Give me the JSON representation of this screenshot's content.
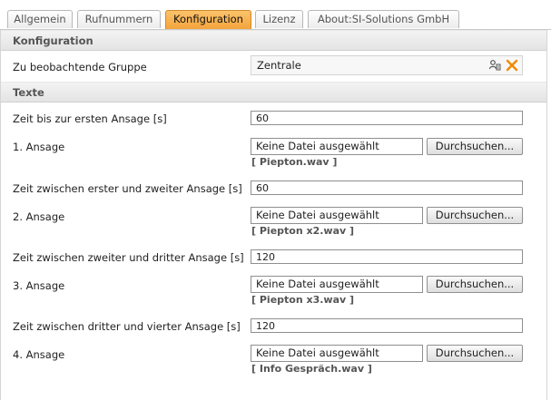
{
  "tabs": [
    {
      "label": "Allgemein"
    },
    {
      "label": "Rufnummern"
    },
    {
      "label": "Konfiguration"
    },
    {
      "label": "Lizenz"
    },
    {
      "label": "About:SI-Solutions GmbH"
    }
  ],
  "active_tab_color": "#f4a43b",
  "section_konfiguration": {
    "title": "Konfiguration",
    "group_label": "Zu beobachtende Gruppe",
    "group_value": "Zentrale"
  },
  "section_texte": {
    "title": "Texte",
    "delay1_label": "Zeit bis zur ersten Ansage [s]",
    "delay1_value": "60",
    "ann1_label": "1. Ansage",
    "ann1_file": "Keine Datei ausgewählt",
    "ann1_current": "[ Piepton.wav ]",
    "delay2_label": "Zeit zwischen erster und zweiter Ansage [s]",
    "delay2_value": "60",
    "ann2_label": "2. Ansage",
    "ann2_file": "Keine Datei ausgewählt",
    "ann2_current": "[ Piepton x2.wav ]",
    "delay3_label": "Zeit zwischen zweiter und dritter Ansage [s]",
    "delay3_value": "120",
    "ann3_label": "3. Ansage",
    "ann3_file": "Keine Datei ausgewählt",
    "ann3_current": "[ Piepton x3.wav ]",
    "delay4_label": "Zeit zwischen dritter und vierter Ansage [s]",
    "delay4_value": "120",
    "ann4_label": "4. Ansage",
    "ann4_file": "Keine Datei ausgewählt",
    "ann4_current": "[ Info Gespräch.wav ]",
    "browse_label": "Durchsuchen..."
  },
  "icons": {
    "group_select": "user-group-select-icon",
    "clear": "clear-x-icon"
  }
}
